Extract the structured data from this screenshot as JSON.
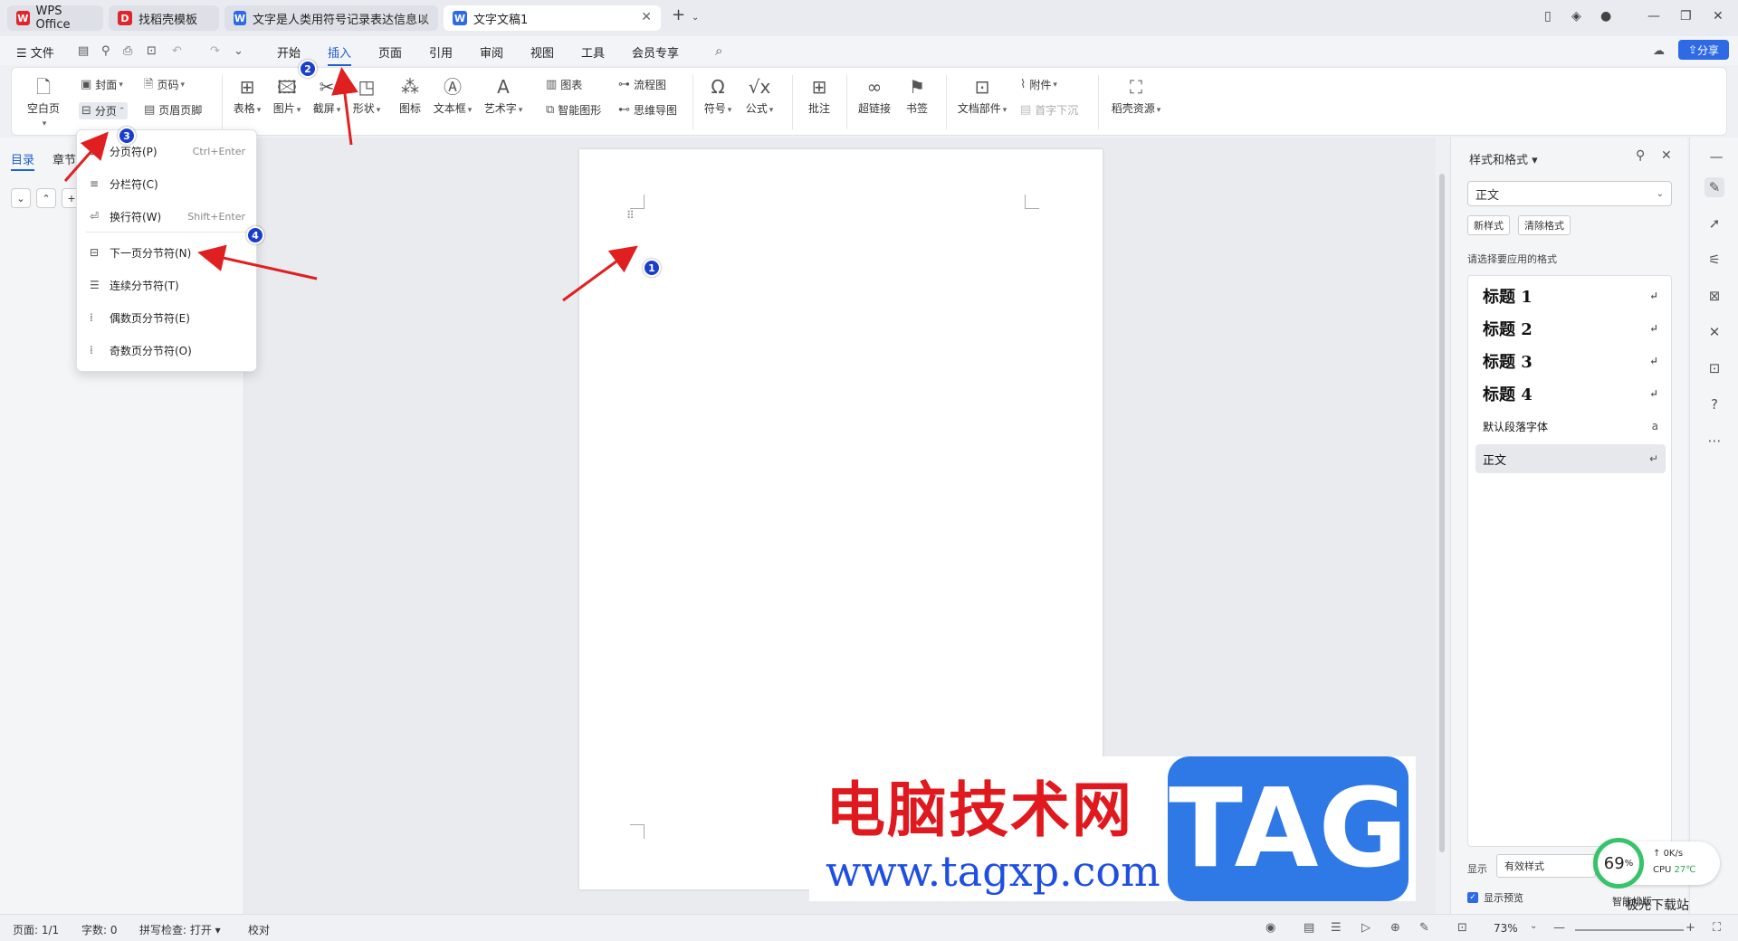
{
  "tabs": [
    {
      "label": "WPS Office",
      "logo": "W",
      "logo_color": "#e0262d"
    },
    {
      "label": "找稻壳模板",
      "logo": "D",
      "logo_color": "#e0262d"
    },
    {
      "label": "文字是人类用符号记录表达信息以",
      "logo": "W",
      "logo_color": "#2f6ae6"
    },
    {
      "label": "文字文稿1",
      "logo": "W",
      "logo_color": "#2f6ae6"
    }
  ],
  "menubar": {
    "file": "文件",
    "items": [
      "开始",
      "插入",
      "页面",
      "引用",
      "审阅",
      "视图",
      "工具",
      "会员专享"
    ],
    "active": "插入",
    "share": "分享"
  },
  "ribbon": {
    "blank_page": "空白页",
    "cover": "封面",
    "page_number": "页码",
    "page_break": "分页",
    "header_footer": "页眉页脚",
    "table": "表格",
    "picture": "图片",
    "screenshot": "截屏",
    "shape": "形状",
    "icon": "图标",
    "textbox": "文本框",
    "wordart": "艺术字",
    "chart": "图表",
    "smart_graphic": "智能图形",
    "flowchart": "流程图",
    "mindmap": "思维导图",
    "symbol": "符号",
    "formula": "公式",
    "comment": "批注",
    "hyperlink": "超链接",
    "bookmark": "书签",
    "doc_parts": "文档部件",
    "attachment": "附件",
    "drop_cap": "首字下沉",
    "docer_resources": "稻壳资源"
  },
  "leftnav": {
    "tabs": [
      "目录",
      "章节"
    ]
  },
  "dropdown": {
    "items": [
      {
        "label": "分页符(P)",
        "shortcut": "Ctrl+Enter"
      },
      {
        "label": "分栏符(C)",
        "shortcut": ""
      },
      {
        "label": "换行符(W)",
        "shortcut": "Shift+Enter"
      },
      {
        "label": "下一页分节符(N)",
        "shortcut": ""
      },
      {
        "label": "连续分节符(T)",
        "shortcut": ""
      },
      {
        "label": "偶数页分节符(E)",
        "shortcut": ""
      },
      {
        "label": "奇数页分节符(O)",
        "shortcut": ""
      }
    ]
  },
  "stylepanel": {
    "title": "样式和格式",
    "current_style": "正文",
    "new_style": "新样式",
    "clear_format": "清除格式",
    "prompt": "请选择要应用的格式",
    "styles": [
      {
        "label": "标题  1"
      },
      {
        "label": "标题  2"
      },
      {
        "label": "标题  3"
      },
      {
        "label": "标题  4"
      },
      {
        "label": "默认段落字体"
      },
      {
        "label": "正文"
      }
    ],
    "show_label": "显示",
    "show_value": "有效样式",
    "preview_label": "显示预览",
    "smart_layout": "智能排版"
  },
  "statusbar": {
    "page": "页面: 1/1",
    "words": "字数: 0",
    "spellcheck": "拼写检查: 打开",
    "proofread": "校对",
    "zoom": "73%"
  },
  "annotations": [
    "1",
    "2",
    "3",
    "4"
  ],
  "watermark": {
    "cn": "电脑技术网",
    "url": "www.tagxp.com",
    "tag": "TAG",
    "site": "极光下载站"
  },
  "cpu_widget": {
    "percent": "69",
    "percent_unit": "%",
    "speed": "0K/s",
    "cpu_label": "CPU",
    "temp": "27℃"
  }
}
